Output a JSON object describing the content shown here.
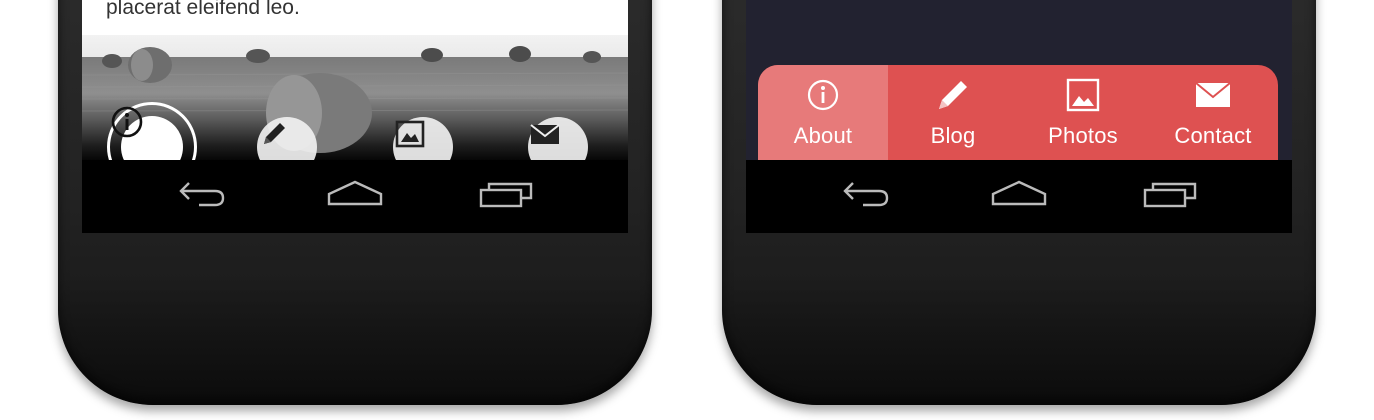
{
  "left_phone": {
    "body_text": "placerat eleifend leo.",
    "fab_buttons": [
      {
        "name": "info-fab",
        "icon": "info-icon",
        "active": true
      },
      {
        "name": "blog-fab",
        "icon": "pencil-icon",
        "active": false
      },
      {
        "name": "photos-fab",
        "icon": "image-icon",
        "active": false
      },
      {
        "name": "contact-fab",
        "icon": "mail-icon",
        "active": false
      }
    ]
  },
  "right_phone": {
    "tabs": [
      {
        "label": "About",
        "icon": "info-icon",
        "active": true
      },
      {
        "label": "Blog",
        "icon": "pencil-icon",
        "active": false
      },
      {
        "label": "Photos",
        "icon": "image-icon",
        "active": false
      },
      {
        "label": "Contact",
        "icon": "mail-icon",
        "active": false
      }
    ],
    "tab_color": "#de5151",
    "active_tab_color": "#e77a7a",
    "screen_bg": "#222230"
  },
  "navbar": {
    "buttons": [
      "back-icon",
      "home-icon",
      "recents-icon"
    ]
  }
}
